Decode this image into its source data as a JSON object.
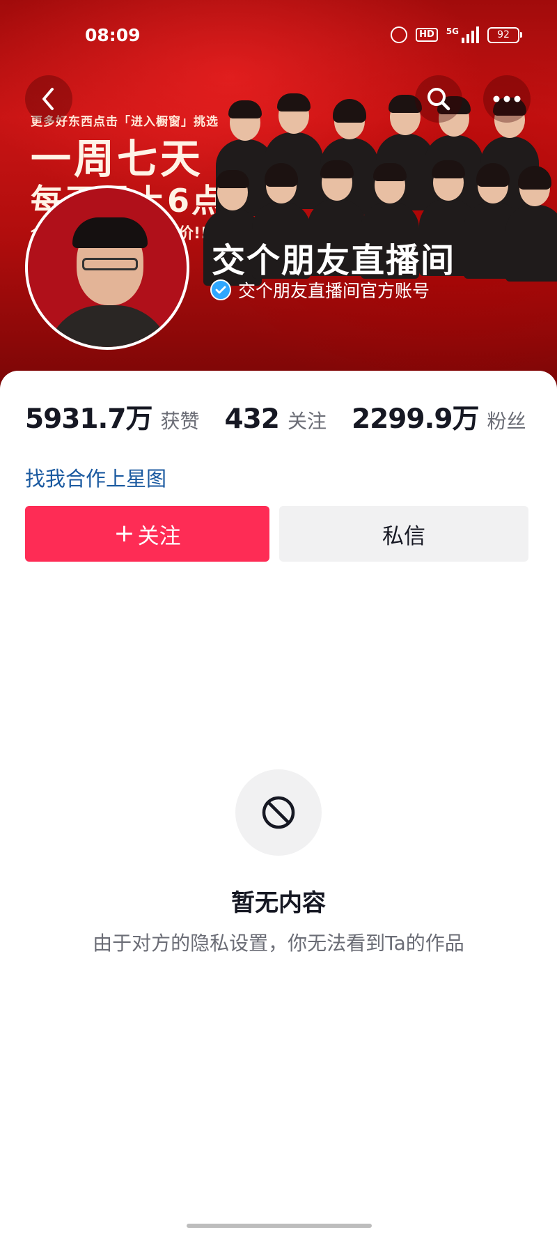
{
  "status_bar": {
    "time": "08:09",
    "hd": "HD",
    "network": "5G",
    "battery": "92",
    "icons": [
      "alarm-icon",
      "hd-icon",
      "signal-icon",
      "battery-icon"
    ]
  },
  "banner": {
    "promo_line1": "更多好东西点击「进入橱窗」挑选",
    "promo_line2": "一周七天",
    "promo_line3": "每天早上6点",
    "promo_line4": "全",
    "promo_line4b": "值价!!!",
    "back_icon": "chevron-left-icon",
    "search_icon": "search-icon",
    "more_icon": "more-dots-icon"
  },
  "profile": {
    "name": "交个朋友直播间",
    "verified_label": "交个朋友直播间官方账号",
    "verified_icon": "verified-check-icon"
  },
  "stats": [
    {
      "value": "5931.7万",
      "label": "获赞"
    },
    {
      "value": "432",
      "label": "关注"
    },
    {
      "value": "2299.9万",
      "label": "粉丝"
    }
  ],
  "star_link": "找我合作上星图",
  "actions": {
    "follow_plus": "+",
    "follow_label": "关注",
    "message_label": "私信"
  },
  "empty_state": {
    "icon": "no-entry-icon",
    "title": "暂无内容",
    "subtitle": "由于对方的隐私设置，你无法看到Ta的作品"
  },
  "colors": {
    "accent": "#fe2c55",
    "link": "#1b5aa0",
    "verified": "#2fa7ff",
    "banner_red": "#c81414"
  }
}
